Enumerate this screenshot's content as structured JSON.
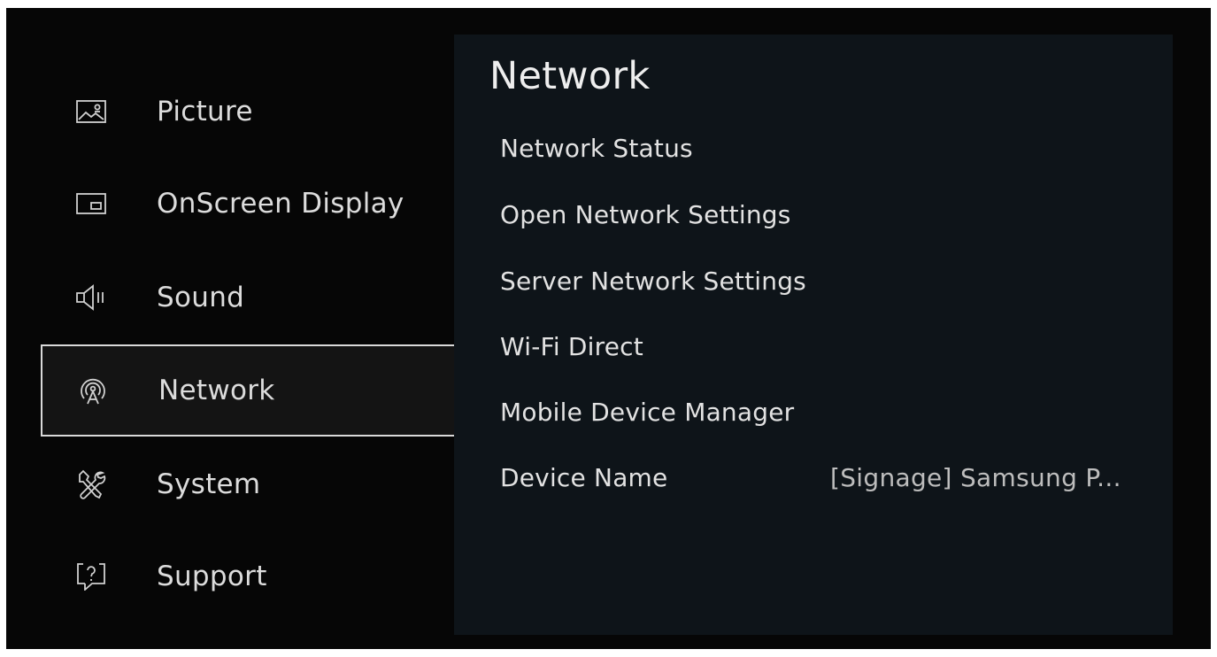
{
  "sidebar": {
    "items": [
      {
        "label": "Picture",
        "icon": "picture-icon"
      },
      {
        "label": "OnScreen Display",
        "icon": "onscreen-display-icon"
      },
      {
        "label": "Sound",
        "icon": "speaker-icon"
      },
      {
        "label": "Network",
        "icon": "network-antenna-icon",
        "selected": true
      },
      {
        "label": "System",
        "icon": "tools-icon"
      },
      {
        "label": "Support",
        "icon": "help-bubble-icon"
      }
    ]
  },
  "content": {
    "title": "Network",
    "items": [
      {
        "label": "Network Status"
      },
      {
        "label": "Open Network Settings"
      },
      {
        "label": "Server Network Settings"
      },
      {
        "label": "Wi-Fi Direct"
      },
      {
        "label": "Mobile Device Manager"
      },
      {
        "label": "Device Name",
        "value": "[Signage] Samsung P..."
      }
    ]
  },
  "colors": {
    "background": "#060606",
    "panel": "#0e1419",
    "selection_border": "#d9d9d9",
    "text": "#e2e2e2"
  }
}
